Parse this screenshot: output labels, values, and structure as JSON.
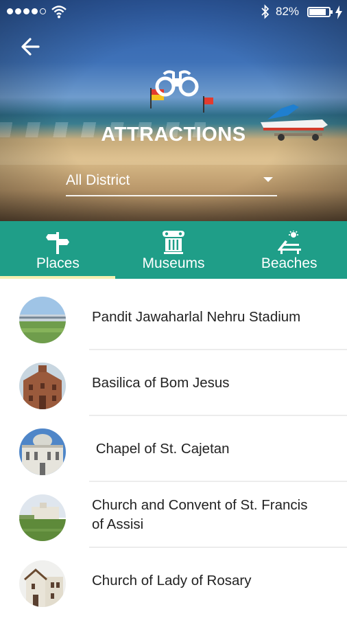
{
  "status_bar": {
    "battery_percent": "82%"
  },
  "header": {
    "title": "ATTRACTIONS",
    "district_select": {
      "value": "All District"
    }
  },
  "tabs": [
    {
      "label": "Places",
      "icon": "signpost-icon",
      "selected": true
    },
    {
      "label": "Museums",
      "icon": "column-icon",
      "selected": false
    },
    {
      "label": "Beaches",
      "icon": "sun-lounger-icon",
      "selected": false
    }
  ],
  "list": [
    {
      "name": "Pandit Jawaharlal Nehru Stadium"
    },
    {
      "name": "Basilica of Bom Jesus"
    },
    {
      "name": " Chapel of St. Cajetan"
    },
    {
      "name": "Church and Convent of St. Francis of Assisi"
    },
    {
      "name": "Church of Lady of Rosary"
    }
  ],
  "colors": {
    "tab_bar": "#1f9e88",
    "tab_indicator": "#f5f0b0",
    "text_primary": "#222222"
  }
}
